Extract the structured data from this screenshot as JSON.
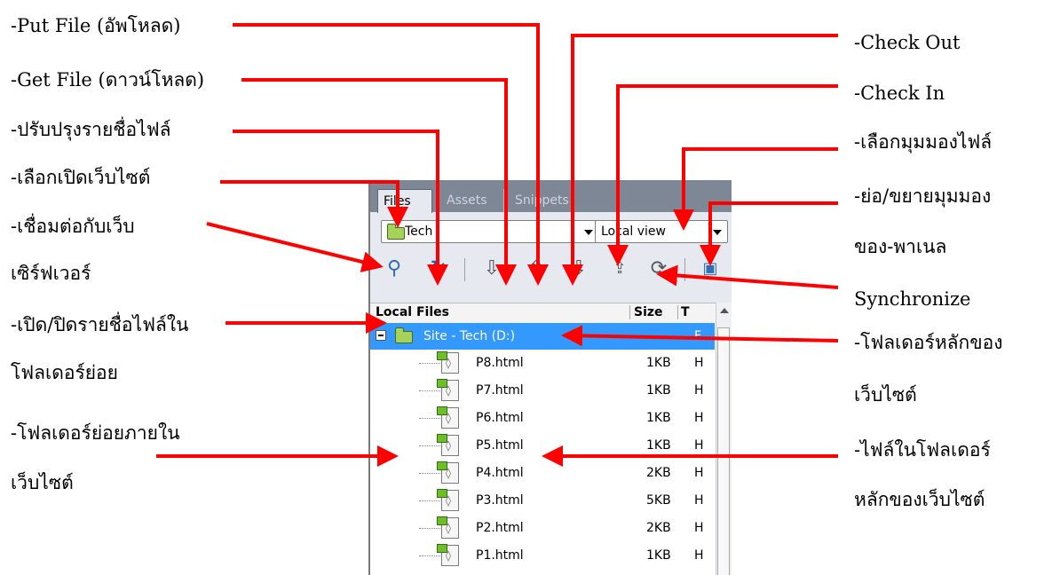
{
  "annotations_left": {
    "put_file": "-Put File (อัพโหลด)",
    "get_file": "-Get File (ดาวน์โหลด)",
    "refresh": "-ปรับปรุงรายชื่อไฟล์",
    "site_select": "-เลือกเปิดเว็บไซต์",
    "connect_1": "-เชื่อมต่อกับเว็บ",
    "connect_2": "เซิร์ฟเวอร์",
    "expand_1": "-เปิด/ปิดรายชื่อไฟล์ใน",
    "expand_2": "โฟลเดอร์ย่อย",
    "subfolder_1": "-โฟลเดอร์ย่อยภายใน",
    "subfolder_2": "เว็บไซต์"
  },
  "annotations_right": {
    "check_out": "-Check Out",
    "check_in": "-Check In",
    "view_select": "-เลือกมุมมองไฟล์",
    "collapse_1": "-ย่อ/ขยายมุมมอง",
    "collapse_2": "ของ-พาเนล",
    "synchronize": "Synchronize",
    "root_folder_1": "-โฟลเดอร์หลักของ",
    "root_folder_2": "เว็บไซต์",
    "root_files_1": "-ไฟล์ในโฟลเดอร์",
    "root_files_2": "หลักของเว็บไซต์"
  },
  "panel": {
    "tabs": [
      "Files",
      "Assets",
      "Snippets"
    ],
    "site_dropdown": "Tech",
    "view_dropdown": "Local view",
    "columns": {
      "name": "Local Files",
      "size": "Size",
      "type": "T"
    },
    "root": {
      "name": "Site - Tech (D:)",
      "type": "F"
    },
    "files": [
      {
        "name": "P8.html",
        "size": "1KB",
        "type": "H"
      },
      {
        "name": "P7.html",
        "size": "1KB",
        "type": "H"
      },
      {
        "name": "P6.html",
        "size": "1KB",
        "type": "H"
      },
      {
        "name": "P5.html",
        "size": "1KB",
        "type": "H"
      },
      {
        "name": "P4.html",
        "size": "2KB",
        "type": "H"
      },
      {
        "name": "P3.html",
        "size": "5KB",
        "type": "H"
      },
      {
        "name": "P2.html",
        "size": "2KB",
        "type": "H"
      },
      {
        "name": "P1.html",
        "size": "1KB",
        "type": "H"
      }
    ],
    "toolbar_icons": [
      "connect-icon",
      "refresh-icon",
      "get-file-icon",
      "put-file-icon",
      "check-out-icon",
      "check-in-icon",
      "synchronize-icon",
      "expand-panel-icon"
    ]
  },
  "colors": {
    "arrow": "#ff0000",
    "selection": "#3399ff",
    "tabbar": "#7e8795"
  }
}
